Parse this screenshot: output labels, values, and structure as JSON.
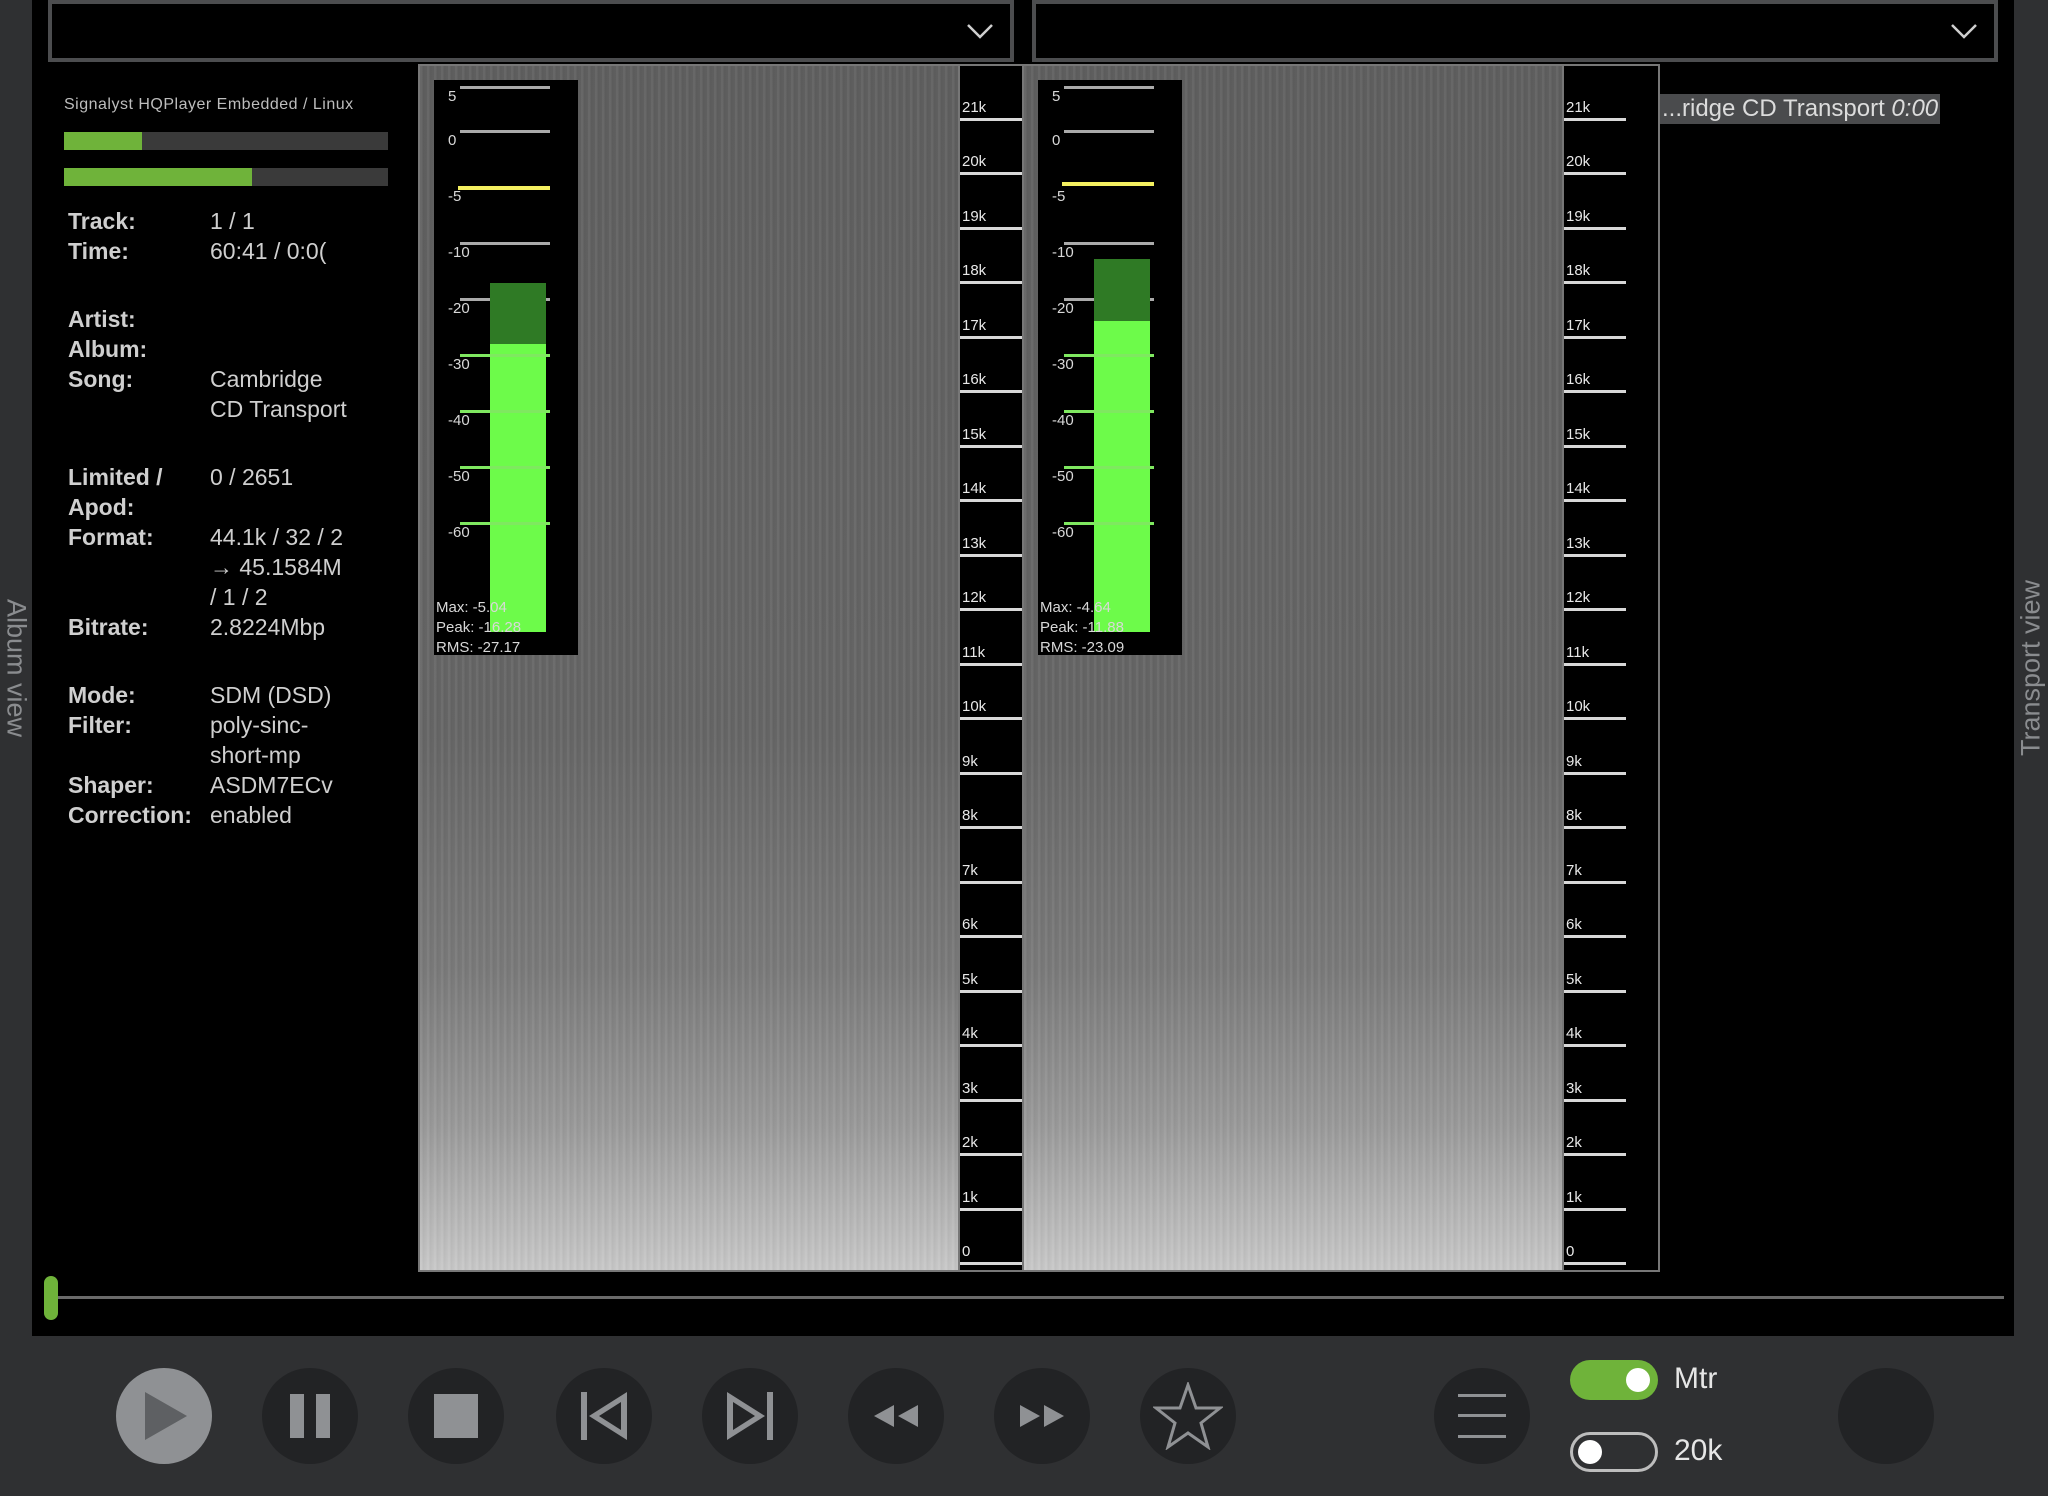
{
  "side_tabs": {
    "left": "Album view",
    "right": "Transport view"
  },
  "brand": "Signalyst HQPlayer Embedded / Linux",
  "level_bars": [
    0.24,
    0.58
  ],
  "info_groups": [
    [
      {
        "k": "Track:",
        "v": "1 / 1"
      },
      {
        "k": "Time:",
        "v": "60:41 / 0:0("
      }
    ],
    [
      {
        "k": "Artist:",
        "v": ""
      },
      {
        "k": "Album:",
        "v": ""
      },
      {
        "k": "Song:",
        "v": "Cambridge CD Transport"
      }
    ],
    [
      {
        "k": "Limited / Apod:",
        "v": "0 / 2651"
      },
      {
        "k": "Format:",
        "v": "44.1k / 32 / 2 → 45.1584M / 1 / 2"
      },
      {
        "k": "Bitrate:",
        "v": "2.8224Mbp"
      }
    ],
    [
      {
        "k": "Mode:",
        "v": "SDM (DSD)"
      },
      {
        "k": "Filter:",
        "v": "poly-sinc-short-mp"
      },
      {
        "k": "Shaper:",
        "v": "ASDM7ECv"
      },
      {
        "k": "Correction:",
        "v": "enabled"
      }
    ]
  ],
  "freq_labels": [
    "21k",
    "20k",
    "19k",
    "18k",
    "17k",
    "16k",
    "15k",
    "14k",
    "13k",
    "12k",
    "11k",
    "10k",
    "9k",
    "8k",
    "7k",
    "6k",
    "5k",
    "4k",
    "3k",
    "2k",
    "1k",
    "0"
  ],
  "db_labels": [
    "5",
    "0",
    "-5",
    "-10",
    "-20",
    "-30",
    "-40",
    "-50",
    "-60"
  ],
  "meters": [
    {
      "max": "Max: -5.04",
      "peak": "Peak: -16.28",
      "rms": "RMS: -27.17",
      "max_db": -5.04,
      "peak_db": -16.28,
      "rms_db": -27.17
    },
    {
      "max": "Max: -4.64",
      "peak": "Peak: -11.88",
      "rms": "RMS: -23.09",
      "max_db": -4.64,
      "peak_db": -11.88,
      "rms_db": -23.09
    }
  ],
  "now_playing": {
    "text": "...ridge CD Transport",
    "time": "0:00"
  },
  "seek_position": 0.0,
  "toggles": [
    {
      "label": "Mtr",
      "on": true
    },
    {
      "label": "20k",
      "on": false
    }
  ],
  "colors": {
    "accent": "#6fb33a",
    "meter_bright": "#6dfb4a",
    "meter_dark": "#2f7a25",
    "hold": "#f4f060"
  }
}
